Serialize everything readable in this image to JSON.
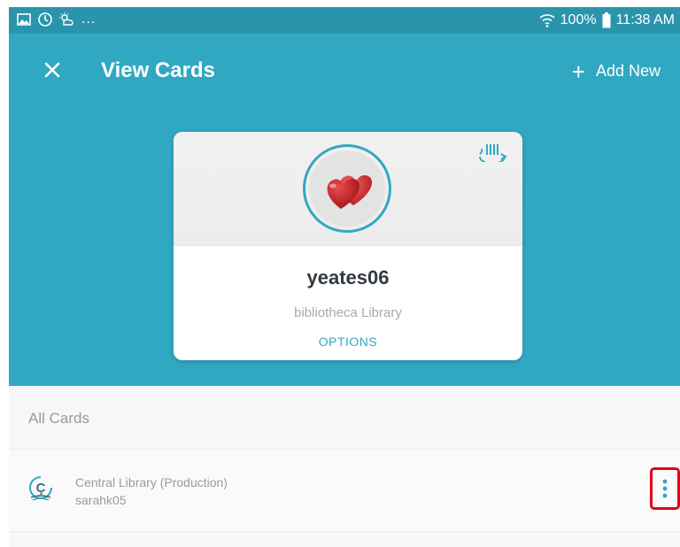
{
  "status_bar": {
    "icons_left": [
      "gallery-icon",
      "sync-icon",
      "weather-icon"
    ],
    "ellipsis": "...",
    "battery": "100%",
    "time": "11:38 AM"
  },
  "app_bar": {
    "title": "View Cards",
    "add_new_label": "Add New",
    "colors": {
      "primary": "#31a8c2",
      "status": "#2a94ad"
    }
  },
  "active_card": {
    "name": "yeates06",
    "library": "bibliotheca Library",
    "options_label": "OPTIONS",
    "avatar": "hearts-avatar",
    "barcode_icon": "barcode-flip-icon"
  },
  "all_cards": {
    "section_label": "All Cards",
    "items": [
      {
        "library": "Central Library (Production)",
        "username": "sarahk05",
        "logo": "library-logo-icon",
        "more_icon": "more-vertical-icon"
      }
    ]
  }
}
